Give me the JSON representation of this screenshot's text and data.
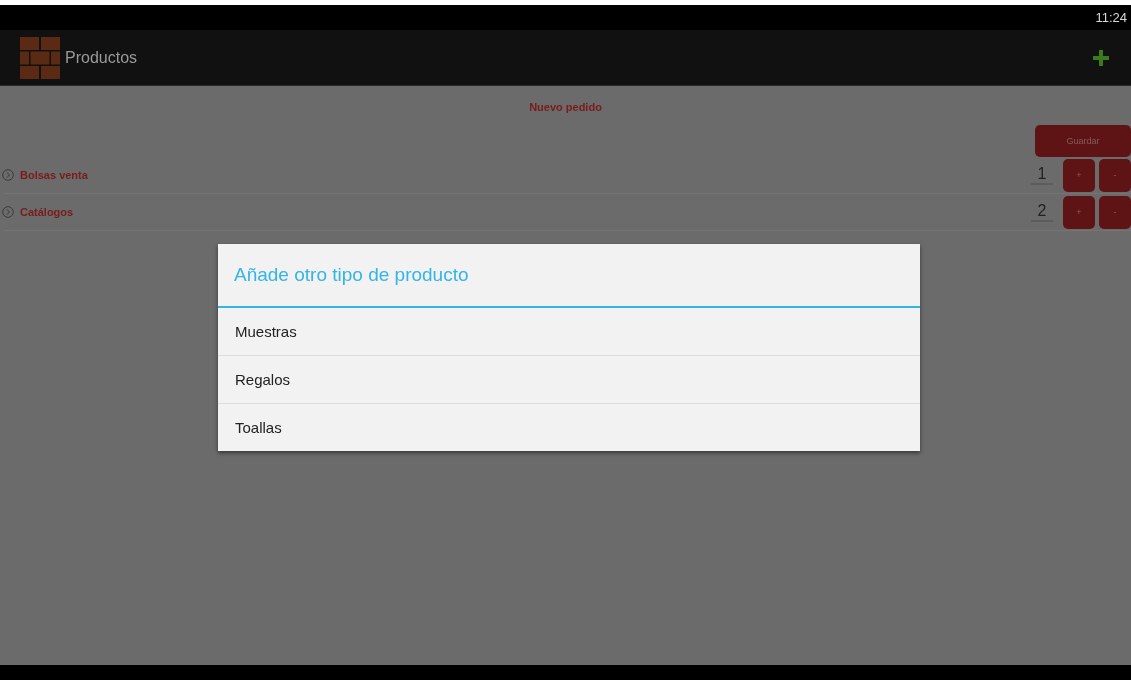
{
  "status_bar": {
    "time": "11:24"
  },
  "action_bar": {
    "title": "Productos"
  },
  "order": {
    "heading": "Nuevo pedido",
    "save_button": "Guardar",
    "items": [
      {
        "name": "Bolsas venta",
        "quantity": "1",
        "plus": "+",
        "minus": "-"
      },
      {
        "name": "Catálogos",
        "quantity": "2",
        "plus": "+",
        "minus": "-"
      }
    ]
  },
  "dialog": {
    "title": "Añade otro tipo de producto",
    "options": [
      "Muestras",
      "Regalos",
      "Toallas"
    ]
  }
}
